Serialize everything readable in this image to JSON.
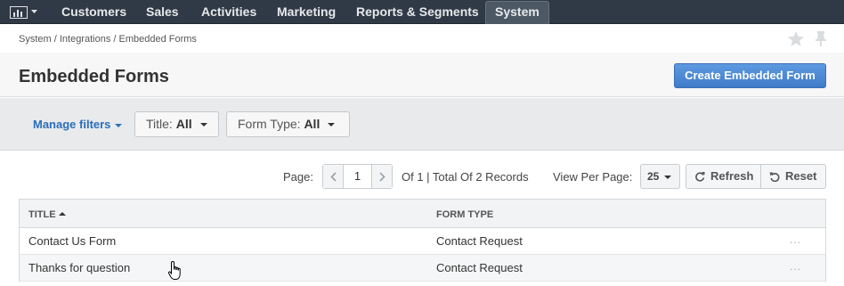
{
  "nav": {
    "logo_icon": "bar-chart-icon",
    "items": [
      "Customers",
      "Sales",
      "Activities",
      "Marketing",
      "Reports & Segments",
      "System"
    ],
    "active": "System"
  },
  "breadcrumb": "System / Integrations / Embedded Forms",
  "page": {
    "title": "Embedded Forms",
    "create_button": "Create Embedded Form"
  },
  "filters": {
    "manage_label": "Manage filters",
    "title_label": "Title:",
    "title_value": "All",
    "form_type_label": "Form Type:",
    "form_type_value": "All"
  },
  "pager": {
    "page_label": "Page:",
    "page_value": "1",
    "summary": "Of 1 | Total Of 2 Records",
    "per_page_label": "View Per Page:",
    "per_page_value": "25",
    "refresh_label": "Refresh",
    "reset_label": "Reset"
  },
  "grid": {
    "columns": [
      "TITLE",
      "FORM TYPE"
    ],
    "rows": [
      {
        "title": "Contact Us Form",
        "form_type": "Contact Request",
        "actions": "..."
      },
      {
        "title": "Thanks for question",
        "form_type": "Contact Request",
        "actions": "..."
      }
    ]
  },
  "colors": {
    "nav_bg": "#303a46",
    "primary_button": "#4f8bd6",
    "link": "#2a6ebb"
  }
}
